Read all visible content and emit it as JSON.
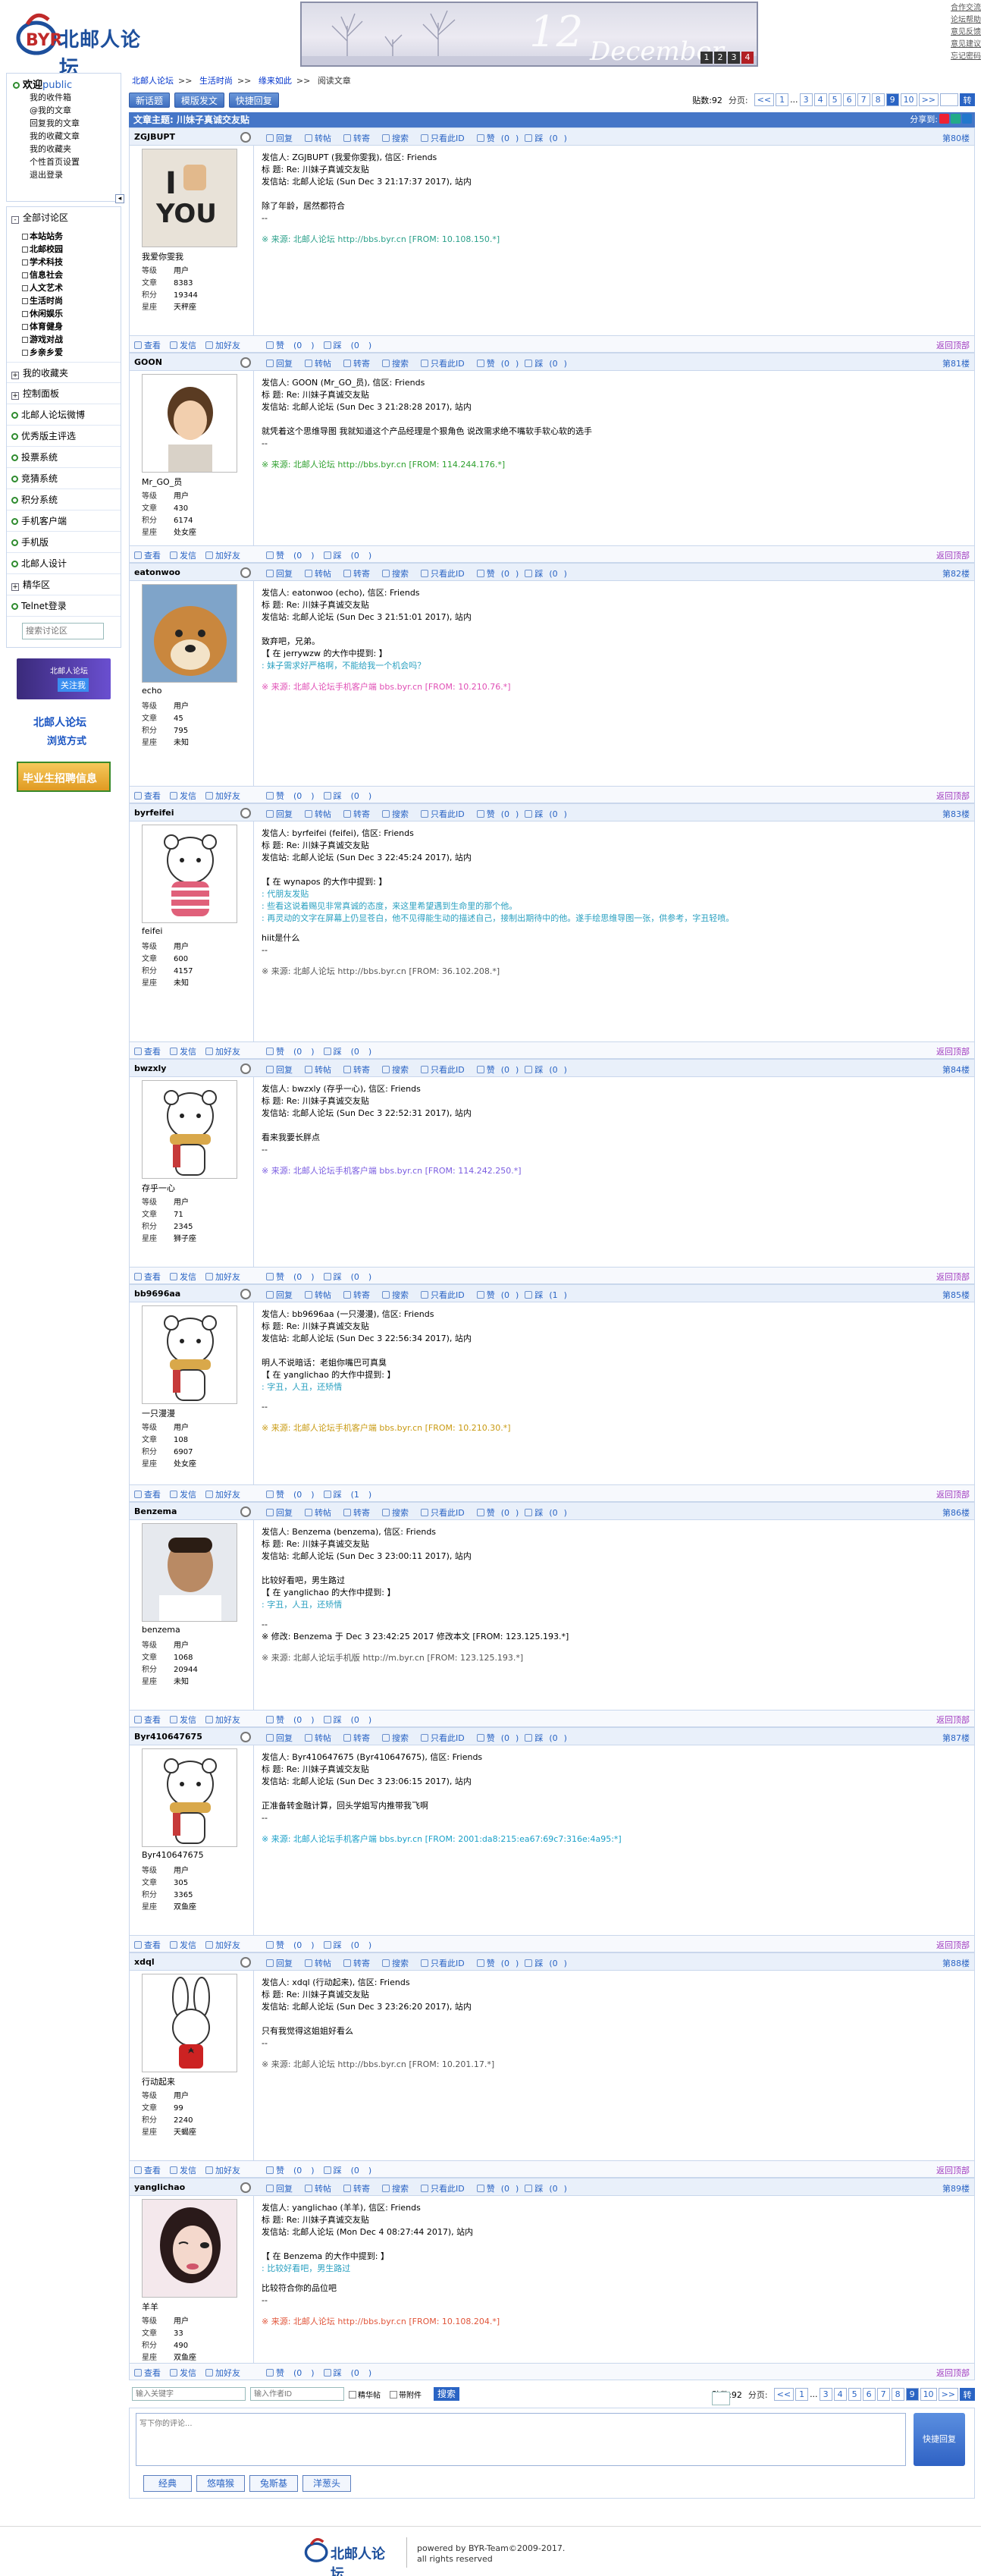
{
  "site": {
    "name": "北邮人论坛",
    "top_links": [
      "合作交流",
      "论坛帮助",
      "意见反馈",
      "意见建议",
      "忘记密码"
    ],
    "banner": {
      "day": "12",
      "month": "December",
      "nums": [
        "1",
        "2",
        "3",
        "4"
      ]
    }
  },
  "sidebar": {
    "welcome": "欢迎",
    "user": "public",
    "user_links": [
      "我的收件箱",
      "@我的文章",
      "回复我的文章",
      "我的收藏文章",
      "我的收藏夹",
      "个性首页设置",
      "退出登录"
    ],
    "section_title": "全部讨论区",
    "sections": [
      "本站站务",
      "北邮校园",
      "学术科技",
      "信息社会",
      "人文艺术",
      "生活时尚",
      "休闲娱乐",
      "体育健身",
      "游戏对战",
      "乡亲乡爱"
    ],
    "menus": [
      "我的收藏夹",
      "控制面板",
      "北邮人论坛微博",
      "优秀版主评选",
      "投票系统",
      "竞猜系统",
      "积分系统",
      "手机客户端",
      "手机版",
      "北邮人设计",
      "精华区",
      "Telnet登录"
    ],
    "search_placeholder": "搜索讨论区",
    "ads": [
      {
        "title": "北邮人论坛",
        "sub": "关注我"
      },
      {
        "title": "北邮人论坛",
        "sub": "浏览方式"
      },
      {
        "title": "毕业生招聘信息",
        "sub": ""
      }
    ]
  },
  "breadcrumb": [
    "北邮人论坛",
    "生活时尚",
    "缘来如此",
    "阅读文章"
  ],
  "toolbar": {
    "buttons": [
      "新话题",
      "模版发文",
      "快捷回复"
    ],
    "post_count_label": "贴数:92",
    "page_label": "分页:",
    "pages": [
      "<<",
      "1",
      "...",
      "3",
      "4",
      "5",
      "6",
      "7",
      "8",
      "9",
      "10",
      ">>"
    ],
    "current_page": "9",
    "go": "转"
  },
  "thread": {
    "title": "文章主题: 川妹子真诚交友贴",
    "share_label": "分享到:"
  },
  "labels": {
    "rank": "等级",
    "posts": "文章",
    "score": "积分",
    "star": "星座",
    "user_rank": "用户",
    "actions": {
      "reply": "回复",
      "forward": "转帖",
      "repost": "转寄",
      "search": "搜索",
      "only": "只看此ID",
      "like": "赞",
      "dislike": "踩"
    },
    "foot": {
      "view": "查看",
      "msg": "发信",
      "add": "加好友"
    },
    "back": "返回顶部"
  },
  "posts": [
    {
      "id": "ZGJBUPT",
      "nick": "我爱你雯我",
      "floor": "第80楼",
      "posts": "8383",
      "score": "19344",
      "star": "天秤座",
      "likes": "0",
      "dislikes": "0",
      "hdr1": "发信人: ZGJBUPT (我爱你雯我), 信区: Friends",
      "hdr2": "标  题: Re: 川妹子真诚交友贴",
      "hdr3": "发信站: 北邮人论坛 (Sun Dec  3 21:17:37 2017), 站内",
      "body": [
        "除了年龄，居然都符合",
        "--"
      ],
      "quote": [],
      "src": "※ 来源: 北邮人论坛 http://bbs.byr.cn [FROM: 10.108.150.*]",
      "srccolor": "#2aa08a",
      "avatar": "thumb"
    },
    {
      "id": "GOON",
      "nick": "Mr_GO_员",
      "floor": "第81楼",
      "posts": "430",
      "score": "6174",
      "star": "处女座",
      "likes": "0",
      "dislikes": "0",
      "hdr1": "发信人: GOON (Mr_GO_员), 信区: Friends",
      "hdr2": "标  题: Re: 川妹子真诚交友贴",
      "hdr3": "发信站: 北邮人论坛 (Sun Dec  3 21:28:28 2017), 站内",
      "body": [
        "就凭着这个思维导图 我就知道这个产品经理是个狠角色 说改需求绝不嘴软手软心软的选手",
        "--"
      ],
      "quote": [],
      "src": "※ 来源: 北邮人论坛 http://bbs.byr.cn [FROM: 114.244.176.*]",
      "srccolor": "#2ea02e",
      "avatar": "boy"
    },
    {
      "id": "eatonwoo",
      "nick": "echo",
      "floor": "第82楼",
      "posts": "45",
      "score": "795",
      "star": "未知",
      "likes": "0",
      "dislikes": "0",
      "hdr1": "发信人: eatonwoo (echo), 信区: Friends",
      "hdr2": "标  题: Re: 川妹子真诚交友贴",
      "hdr3": "发信站: 北邮人论坛 (Sun Dec  3 21:51:01 2017), 站内",
      "body": [
        "致弃吧，兄弟。",
        "【 在 jerrywzw 的大作中提到: 】"
      ],
      "quote": [
        ": 妹子需求好严格啊，不能给我一个机会吗？"
      ],
      "src": "※ 来源: 北邮人论坛手机客户端 bbs.byr.cn [FROM: 10.210.76.*]",
      "srccolor": "#e04fb5",
      "avatar": "dog"
    },
    {
      "id": "byrfeifei",
      "nick": "feifei",
      "floor": "第83楼",
      "posts": "600",
      "score": "4157",
      "star": "未知",
      "likes": "0",
      "dislikes": "0",
      "hdr1": "发信人: byrfeifei (feifei), 信区: Friends",
      "hdr2": "标  题: Re: 川妹子真诚交友贴",
      "hdr3": "发信站: 北邮人论坛 (Sun Dec  3 22:45:24 2017), 站内",
      "body": [
        "【 在 wynapos 的大作中提到: 】"
      ],
      "quote": [
        ": 代朋友发贴",
        ": 些看这说着赐见非常真诚的态度，来这里希望遇到生命里的那个他。",
        ": 再灵动的文字在屏幕上仍显苍白，他不见得能生动的描述自己，接制出期待中的他。遂手绘思维导图一张，供参考，字丑轻喷。"
      ],
      "tail": [
        "hiit是什么",
        "--"
      ],
      "src": "※ 来源: 北邮人论坛 http://bbs.byr.cn [FROM: 36.102.208.*]",
      "srccolor": "#555",
      "avatar": "bear1"
    },
    {
      "id": "bwzxly",
      "nick": "存乎一心",
      "floor": "第84楼",
      "posts": "71",
      "score": "2345",
      "star": "狮子座",
      "likes": "0",
      "dislikes": "0",
      "hdr1": "发信人: bwzxly (存乎一心), 信区: Friends",
      "hdr2": "标  题: Re: 川妹子真诚交友贴",
      "hdr3": "发信站: 北邮人论坛 (Sun Dec  3 22:52:31 2017), 站内",
      "body": [
        "看来我要长胖点",
        "--"
      ],
      "quote": [],
      "src": "※ 来源: 北邮人论坛手机客户端 bbs.byr.cn [FROM: 114.242.250.*]",
      "srccolor": "#7a5ce0",
      "avatar": "bear2"
    },
    {
      "id": "bb9696aa",
      "nick": "一只漫漫",
      "floor": "第85楼",
      "posts": "108",
      "score": "6907",
      "star": "处女座",
      "likes": "0",
      "dislikes": "1",
      "hdr1": "发信人: bb9696aa (一只漫漫), 信区: Friends",
      "hdr2": "标  题: Re: 川妹子真诚交友贴",
      "hdr3": "发信站: 北邮人论坛 (Sun Dec  3 22:56:34 2017), 站内",
      "body": [
        "明人不说暗话：老姐你嘴巴可真臭",
        "【 在 yanglichao 的大作中提到: 】"
      ],
      "quote": [
        ": 字丑，人丑，还矫情"
      ],
      "tail": [
        "--"
      ],
      "src": "※ 来源: 北邮人论坛手机客户端 bbs.byr.cn [FROM: 10.210.30.*]",
      "srccolor": "#c99a12",
      "avatar": "bear2"
    },
    {
      "id": "Benzema",
      "nick": "benzema",
      "floor": "第86楼",
      "posts": "1068",
      "score": "20944",
      "star": "未知",
      "likes": "0",
      "dislikes": "0",
      "hdr1": "发信人: Benzema (benzema), 信区: Friends",
      "hdr2": "标  题: Re: 川妹子真诚交友贴",
      "hdr3": "发信站: 北邮人论坛 (Sun Dec  3 23:00:11 2017), 站内",
      "body": [
        "比较好看吧，男生路过",
        "【 在 yanglichao 的大作中提到: 】"
      ],
      "quote": [
        ": 字丑，人丑，还矫情"
      ],
      "tail": [
        "--",
        "※ 修改: Benzema 于 Dec  3 23:42:25 2017 修改本文 [FROM: 123.125.193.*]"
      ],
      "src": "※ 来源: 北邮人论坛手机版 http://m.byr.cn [FROM: 123.125.193.*]",
      "srccolor": "#555",
      "avatar": "man"
    },
    {
      "id": "Byr410647675",
      "nick": "Byr410647675",
      "floor": "第87楼",
      "posts": "305",
      "score": "3365",
      "star": "双鱼座",
      "likes": "0",
      "dislikes": "0",
      "hdr1": "发信人: Byr410647675 (Byr410647675), 信区: Friends",
      "hdr2": "标  题: Re: 川妹子真诚交友贴",
      "hdr3": "发信站: 北邮人论坛 (Sun Dec  3 23:06:15 2017), 站内",
      "body": [
        "正准备转金融计算，回头学姐写内推带我飞啊",
        "--"
      ],
      "quote": [],
      "src": "※ 来源: 北邮人论坛手机客户端 bbs.byr.cn [FROM: 2001:da8:215:ea67:69c7:316e:4a95:*]",
      "srccolor": "#1aa0c8",
      "avatar": "bear2"
    },
    {
      "id": "xdql",
      "nick": "行动起来",
      "floor": "第88楼",
      "posts": "99",
      "score": "2240",
      "star": "天蝎座",
      "likes": "0",
      "dislikes": "0",
      "hdr1": "发信人: xdql (行动起来), 信区: Friends",
      "hdr2": "标  题: Re: 川妹子真诚交友贴",
      "hdr3": "发信站: 北邮人论坛 (Sun Dec  3 23:26:20 2017), 站内",
      "body": [
        "只有我觉得这姐姐好看么",
        "--"
      ],
      "quote": [],
      "src": "※ 来源: 北邮人论坛 http://bbs.byr.cn [FROM: 10.201.17.*]",
      "srccolor": "#555",
      "avatar": "rabbit"
    },
    {
      "id": "yanglichao",
      "nick": "羊羊",
      "floor": "第89楼",
      "posts": "33",
      "score": "490",
      "star": "双鱼座",
      "likes": "0",
      "dislikes": "0",
      "hdr1": "发信人: yanglichao (羊羊), 信区: Friends",
      "hdr2": "标  题: Re: 川妹子真诚交友贴",
      "hdr3": "发信站: 北邮人论坛 (Mon Dec  4 08:27:44 2017), 站内",
      "body": [
        "【 在 Benzema 的大作中提到: 】"
      ],
      "quote": [
        ": 比较好看吧，男生路过"
      ],
      "tail": [
        "比较符合你的品位吧",
        "--"
      ],
      "src": "※ 来源: 北邮人论坛 http://bbs.byr.cn [FROM: 10.108.204.*]",
      "srccolor": "#e0553a",
      "avatar": "girl"
    }
  ],
  "bottom": {
    "kw_placeholder": "输入关键字",
    "author_placeholder": "输入作者ID",
    "only_good": "精华帖",
    "with_att": "带附件",
    "search": "搜索",
    "reply_placeholder": "写下你的评论...",
    "quick_reply": "快捷回复",
    "emotions": [
      "经典",
      "悠嘻猴",
      "兔斯基",
      "洋葱头"
    ]
  },
  "footer": {
    "powered": "powered by BYR-Team©2009-2017.",
    "rights": "all rights reserved"
  }
}
